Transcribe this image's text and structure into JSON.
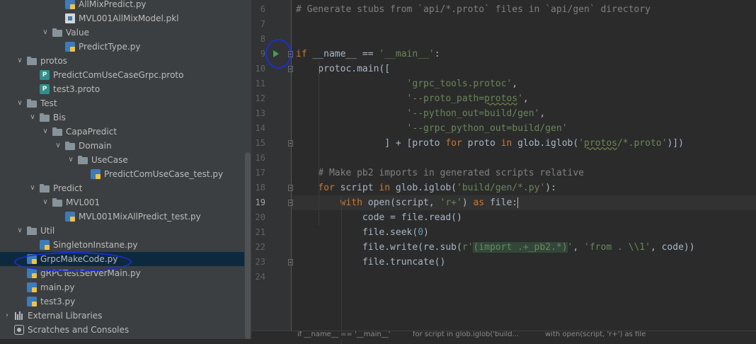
{
  "project_tree": {
    "items": [
      {
        "label": "AllMixPredict.py",
        "icon": "python-file-icon",
        "depth": 4
      },
      {
        "label": "MVL001AllMixModel.pkl",
        "icon": "pickle-file-icon",
        "depth": 4
      },
      {
        "label": "Value",
        "icon": "folder-icon",
        "depth": 3,
        "expanded": true
      },
      {
        "label": "PredictType.py",
        "icon": "python-file-icon",
        "depth": 4
      },
      {
        "label": "protos",
        "icon": "folder-icon",
        "depth": 1,
        "expanded": true
      },
      {
        "label": "PredictComUseCaseGrpc.proto",
        "icon": "proto-file-icon",
        "depth": 2
      },
      {
        "label": "test3.proto",
        "icon": "proto-file-icon",
        "depth": 2
      },
      {
        "label": "Test",
        "icon": "folder-icon",
        "depth": 1,
        "expanded": true
      },
      {
        "label": "Bis",
        "icon": "folder-icon",
        "depth": 2,
        "expanded": true
      },
      {
        "label": "CapaPredict",
        "icon": "folder-icon",
        "depth": 3,
        "expanded": true
      },
      {
        "label": "Domain",
        "icon": "folder-icon",
        "depth": 4,
        "expanded": true
      },
      {
        "label": "UseCase",
        "icon": "folder-icon",
        "depth": 5,
        "expanded": true
      },
      {
        "label": "PredictComUseCase_test.py",
        "icon": "python-file-icon",
        "depth": 6
      },
      {
        "label": "Predict",
        "icon": "folder-icon",
        "depth": 2,
        "expanded": true
      },
      {
        "label": "MVL001",
        "icon": "folder-icon",
        "depth": 3,
        "expanded": true
      },
      {
        "label": "MVL001MixAllPredict_test.py",
        "icon": "python-file-icon",
        "depth": 4
      },
      {
        "label": "Util",
        "icon": "folder-icon",
        "depth": 1,
        "expanded": true
      },
      {
        "label": "SingletonInstane.py",
        "icon": "python-file-icon",
        "depth": 2
      },
      {
        "label": "GrpcMakeCode.py",
        "icon": "python-file-icon",
        "depth": 1,
        "selected": true
      },
      {
        "label": "gRPCTestServerMain.py",
        "icon": "python-file-icon",
        "depth": 1
      },
      {
        "label": "main.py",
        "icon": "python-file-icon",
        "depth": 1
      },
      {
        "label": "test3.py",
        "icon": "python-file-icon",
        "depth": 1
      },
      {
        "label": "External Libraries",
        "icon": "library-icon",
        "depth": 0,
        "expanded": false
      },
      {
        "label": "Scratches and Consoles",
        "icon": "scratches-icon",
        "depth": 0
      }
    ]
  },
  "editor": {
    "current_line": 19,
    "lines": [
      {
        "no": "6",
        "code": "# Generate stubs from `api/*.proto` files in `api/gen` directory"
      },
      {
        "no": "7",
        "code": ""
      },
      {
        "no": "8",
        "code": ""
      },
      {
        "no": "9",
        "code": "if __name__ == '__main__':"
      },
      {
        "no": "10",
        "code": "    protoc.main(["
      },
      {
        "no": "11",
        "code": "                    'grpc_tools.protoc',"
      },
      {
        "no": "12",
        "code": "                    '--proto_path=protos',"
      },
      {
        "no": "13",
        "code": "                    '--python_out=build/gen',"
      },
      {
        "no": "14",
        "code": "                    '--grpc_python_out=build/gen'"
      },
      {
        "no": "15",
        "code": "                ] + [proto for proto in glob.iglob('protos/*.proto')])"
      },
      {
        "no": "16",
        "code": ""
      },
      {
        "no": "17",
        "code": "    # Make pb2 imports in generated scripts relative"
      },
      {
        "no": "18",
        "code": "    for script in glob.iglob('build/gen/*.py'):"
      },
      {
        "no": "19",
        "code": "        with open(script, 'r+') as file:"
      },
      {
        "no": "20",
        "code": "            code = file.read()"
      },
      {
        "no": "21",
        "code": "            file.seek(0)"
      },
      {
        "no": "22",
        "code": "            file.write(re.sub(r'(import .+_pb2.*)', 'from . \\\\1', code))"
      },
      {
        "no": "23",
        "code": "            file.truncate()"
      },
      {
        "no": "24",
        "code": ""
      }
    ]
  },
  "breadcrumb": {
    "items": [
      "if __name__ == '__main__'",
      "for script in glob.iglob('build...",
      "with open(script, 'r+') as file"
    ]
  },
  "colors": {
    "annotation": "#1a2fd6",
    "run_icon": "#499c54",
    "selection": "#0d293e"
  }
}
